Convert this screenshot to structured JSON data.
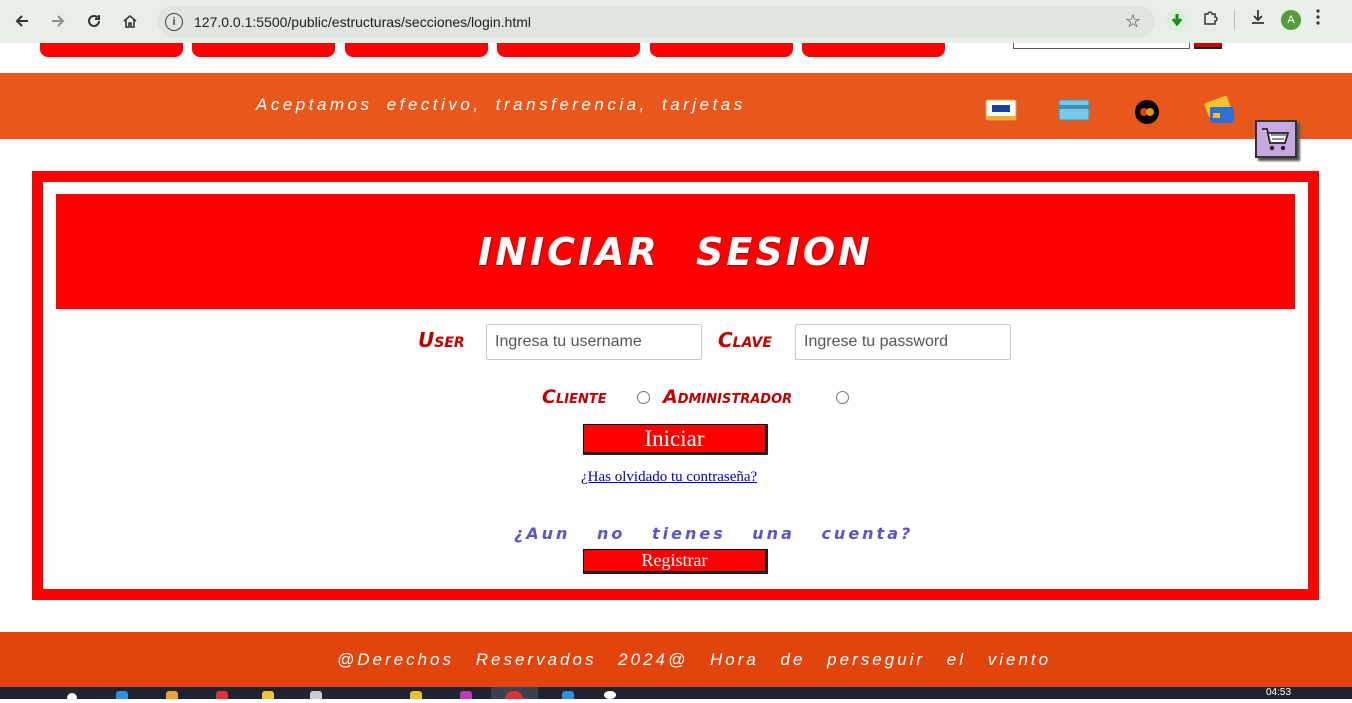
{
  "browser": {
    "url": "127.0.0.1:5500/public/estructuras/secciones/login.html",
    "profile_initial": "A"
  },
  "banner": {
    "text": "Aceptamos efectivo, transferencia, tarjetas",
    "payment_icons": [
      "visa-card-icon",
      "credit-card-icon",
      "mastercard-icon",
      "cards-stack-icon"
    ]
  },
  "login": {
    "title": "INICIAR SESION",
    "user_label": "User",
    "user_placeholder": "Ingresa tu username",
    "password_label": "Clave",
    "password_placeholder": "Ingrese tu password",
    "role_cliente": "Cliente",
    "role_admin": "Administrador",
    "submit_label": "Iniciar",
    "forgot_link": "¿Has olvidado tu contraseña?",
    "no_account": "¿Aun no tienes una cuenta?",
    "register_label": "Registrar"
  },
  "footer": {
    "text": "@Derechos Reservados 2024@ Hora de perseguir el viento"
  },
  "taskbar": {
    "clock": "04:53"
  },
  "colors": {
    "banner": "#e8581c",
    "accent_red": "#ff0000",
    "footer": "#e2440e",
    "label_red": "#c00000",
    "link_purple": "#5a55c8"
  }
}
